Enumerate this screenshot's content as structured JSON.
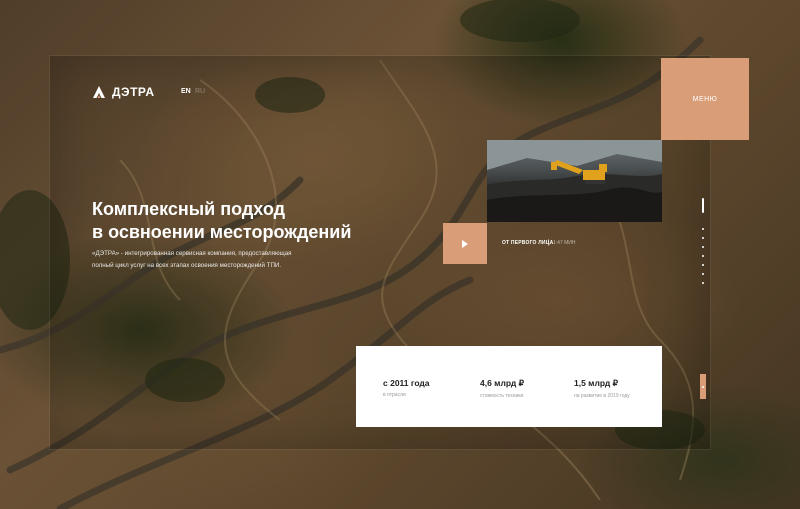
{
  "brand": {
    "name": "ДЭТРА"
  },
  "lang": {
    "current": "EN",
    "alt": "RU"
  },
  "menu": {
    "label": "МЕНЮ"
  },
  "hero": {
    "headline_line1": "Комплексный подход",
    "headline_line2": "в освноении месторождений",
    "description": "«ДЭТРА» - интегрированная сервисная компания, предоставляющая полный цикл услуг на всех этапах освоения месторождений ТПИ."
  },
  "video": {
    "title": "ОТ ПЕРВОГО ЛИЦА",
    "duration": "1:47 МИН"
  },
  "stats": [
    {
      "value": "с 2011 года",
      "caption": "в отрасли"
    },
    {
      "value": "4,6 млрд ₽",
      "caption": "стоимость техники"
    },
    {
      "value": "1,5 млрд ₽",
      "caption": "на развитие в 2019 году"
    }
  ],
  "icons": {
    "logo": "detra-logo-icon",
    "play": "play-icon"
  },
  "colors": {
    "accent": "#d99d78",
    "card": "#ffffff"
  },
  "slider": {
    "slides": 8,
    "active": 1
  }
}
